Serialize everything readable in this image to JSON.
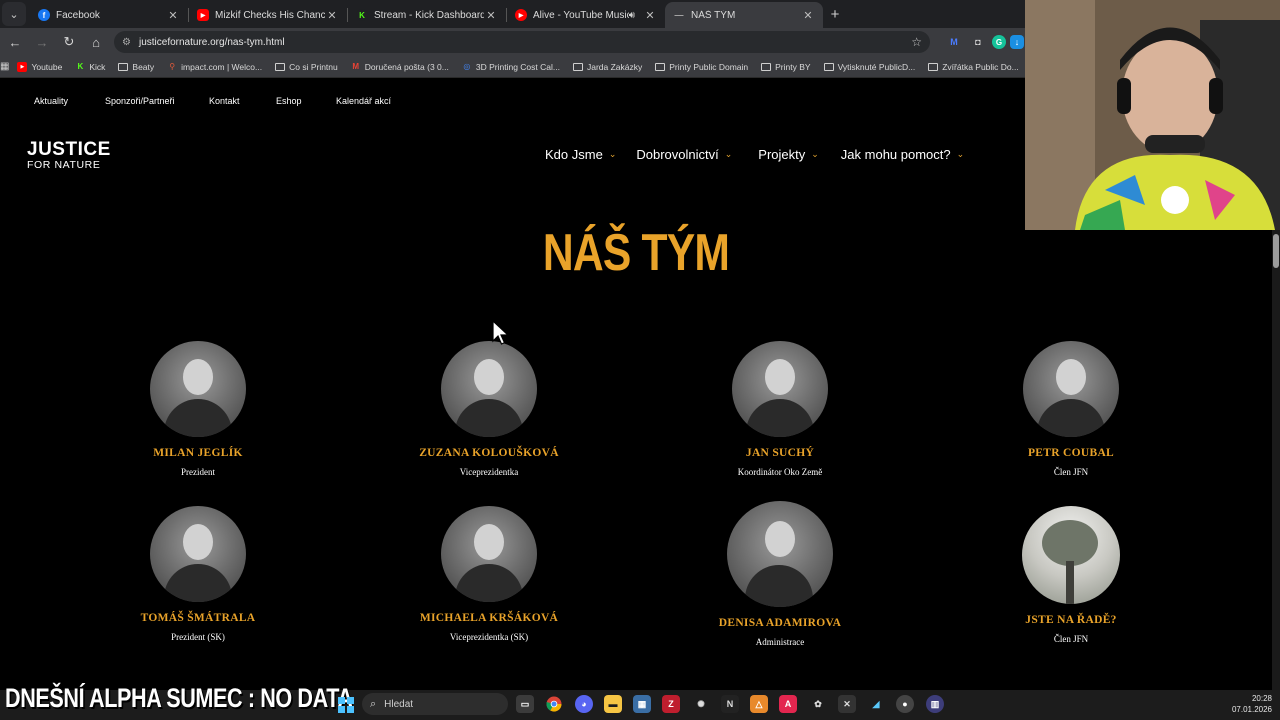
{
  "browser": {
    "tabs": [
      {
        "title": "Facebook",
        "icon": "facebook-icon",
        "color": "#1877f2",
        "glyph": "f"
      },
      {
        "title": "Mizkif Checks His Chances of D",
        "icon": "youtube-icon",
        "color": "#ff0000",
        "glyph": "▶"
      },
      {
        "title": "Stream - Kick Dashboard",
        "icon": "kick-icon",
        "color": "#53fc18",
        "glyph": "K"
      },
      {
        "title": "Alive - YouTube Music",
        "icon": "youtube-music-icon",
        "color": "#ff0000",
        "glyph": "▶"
      },
      {
        "title": "NÁŠ TÝM",
        "icon": "page-icon",
        "color": "#888888",
        "glyph": ""
      }
    ],
    "url": "justicefornature.org/nas-tym.html",
    "bookmarks": [
      {
        "label": "Youtube",
        "icon": "youtube-icon"
      },
      {
        "label": "Kick",
        "icon": "kick-icon"
      },
      {
        "label": "Beaty",
        "icon": "folder-icon"
      },
      {
        "label": "impact.com | Welco...",
        "icon": "impact-icon"
      },
      {
        "label": "Co si Printnu",
        "icon": "folder-icon"
      },
      {
        "label": "Doručená pošta (3 0...",
        "icon": "gmail-icon"
      },
      {
        "label": "3D Printing Cost Cal...",
        "icon": "calc-icon"
      },
      {
        "label": "Jarda Zakázky",
        "icon": "folder-icon"
      },
      {
        "label": "Printy Public Domain",
        "icon": "folder-icon"
      },
      {
        "label": "Printy BY",
        "icon": "folder-icon"
      },
      {
        "label": "Vytisknuté PublicD...",
        "icon": "folder-icon"
      },
      {
        "label": "Zvířátka Public Do...",
        "icon": "folder-icon"
      }
    ]
  },
  "site": {
    "topnav": [
      "Aktuality",
      "Sponzoři/Partneři",
      "Kontakt",
      "Eshop",
      "Kalendář akcí"
    ],
    "logo": {
      "line1": "JUSTICE",
      "line2": "FOR NATURE"
    },
    "mainnav": [
      "Kdo Jsme",
      "Dobrovolnictví",
      "Projekty",
      "Jak mohu pomoct?"
    ],
    "title": "NÁŠ TÝM",
    "members": [
      {
        "name": "MILAN JEGLÍK",
        "role": "Prezident"
      },
      {
        "name": "ZUZANA KOLOUŠKOVÁ",
        "role": "Viceprezidentka"
      },
      {
        "name": "JAN SUCHÝ",
        "role": "Koordinátor Oko Země"
      },
      {
        "name": "PETR COUBAL",
        "role": "Člen JFN"
      },
      {
        "name": "TOMÁŠ ŠMÁTRALA",
        "role": "Prezident (SK)"
      },
      {
        "name": "MICHAELA KRŠÁKOVÁ",
        "role": "Viceprezidentka (SK)"
      },
      {
        "name": "DENISA ADAMIROVA",
        "role": "Administrace"
      },
      {
        "name": "JSTE NA ŘADĚ?",
        "role": "Člen JFN"
      }
    ]
  },
  "overlay": {
    "text": "DNEŠNÍ ALPHA SUMEC : NO DATA"
  },
  "taskbar": {
    "search_placeholder": "Hledat",
    "time": "20:28",
    "date": "07.01.2026"
  },
  "colors": {
    "accent": "#e9a32a",
    "background": "#000000"
  }
}
